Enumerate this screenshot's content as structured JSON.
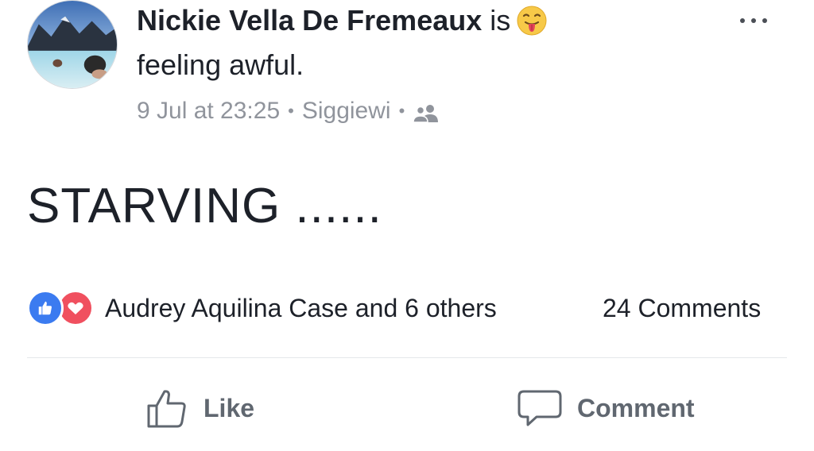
{
  "post": {
    "author": "Nickie Vella De Fremeaux",
    "verb": "is",
    "feeling_icon": "tongue-out-face-icon",
    "feeling": "feeling awful.",
    "timestamp": "9 Jul at 23:25",
    "location": "Siggiewi",
    "separator": "•",
    "audience_icon": "friends-icon",
    "body": "STARVING ......"
  },
  "reactions": {
    "icons": [
      "like-reaction-icon",
      "love-reaction-icon"
    ],
    "summary": "Audrey Aquilina Case and 6 others",
    "comments": "24 Comments"
  },
  "actions": {
    "like_label": "Like",
    "comment_label": "Comment"
  },
  "colors": {
    "like_blue": "#3b7bf0",
    "love_red": "#f0505f",
    "meta_gray": "#90949c",
    "action_gray": "#606770"
  }
}
